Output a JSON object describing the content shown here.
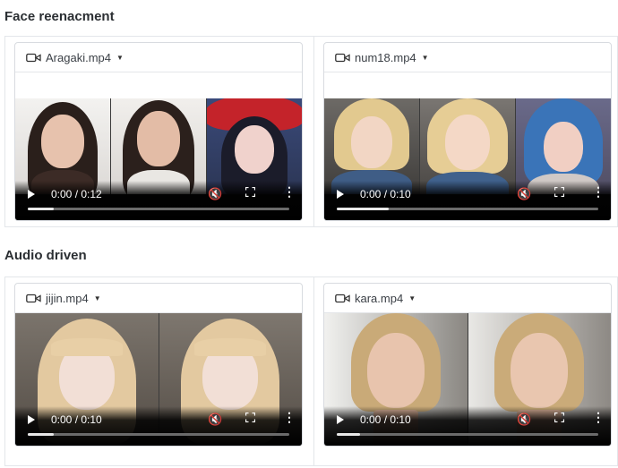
{
  "sections": [
    {
      "title": "Face reenacment",
      "cards": [
        {
          "file": "Aragaki.mp4",
          "time": "0:00 / 0:12",
          "progress": 0.1
        },
        {
          "file": "num18.mp4",
          "time": "0:00 / 0:10",
          "progress": 0.2
        }
      ]
    },
    {
      "title": "Audio driven",
      "cards": [
        {
          "file": "jijin.mp4",
          "time": "0:00 / 0:10",
          "progress": 0.1
        },
        {
          "file": "kara.mp4",
          "time": "0:00 / 0:10",
          "progress": 0.09
        }
      ]
    }
  ],
  "icons": {
    "file": "video-camera-icon",
    "menu": "caret-down-icon",
    "play": "play-icon",
    "mute": "muted-speaker-icon",
    "fullscreen": "fullscreen-icon",
    "more": "more-options-icon"
  },
  "colors": {
    "border": "#d8dbe0",
    "grid_border": "#e3e6ea",
    "control_bar": "#000000",
    "progress_fill": "#e8e8e8"
  }
}
